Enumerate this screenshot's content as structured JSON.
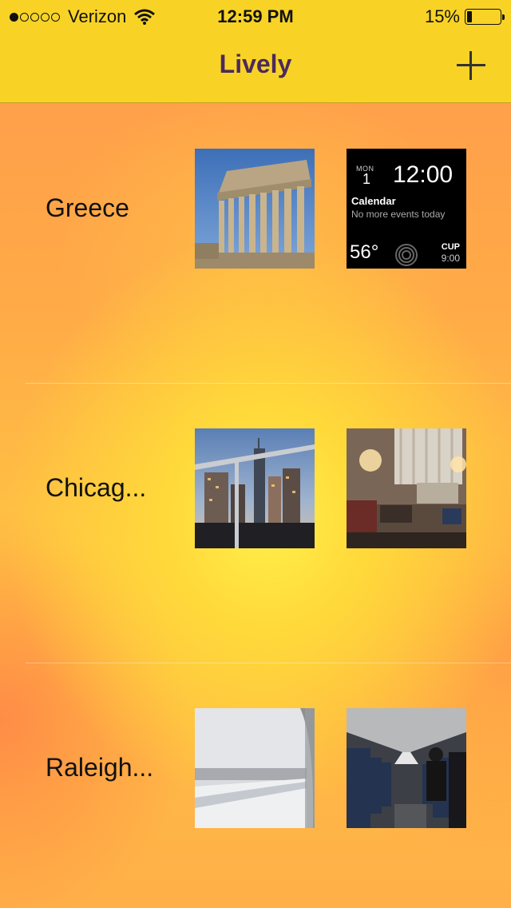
{
  "status_bar": {
    "signal_dots_filled": 1,
    "signal_dots_total": 5,
    "carrier": "Verizon",
    "time": "12:59 PM",
    "battery_percent": "15%",
    "battery_level": 0.15
  },
  "nav": {
    "title": "Lively",
    "add_icon": "plus-icon"
  },
  "trips": [
    {
      "label": "Greece",
      "photos": [
        "parthenon-photo",
        "watch-face-screenshot"
      ],
      "watch": {
        "month": "MON",
        "day": "1",
        "time": "12:00",
        "calendar_title": "Calendar",
        "calendar_text": "No more events today",
        "temperature": "56°",
        "event_name": "CUP",
        "event_time": "9:00"
      }
    },
    {
      "label": "Chicag...",
      "photos": [
        "city-skyline-photo",
        "hotel-room-photo"
      ]
    },
    {
      "label": "Raleigh...",
      "photos": [
        "airplane-window-photo",
        "airplane-cabin-photo"
      ]
    }
  ]
}
